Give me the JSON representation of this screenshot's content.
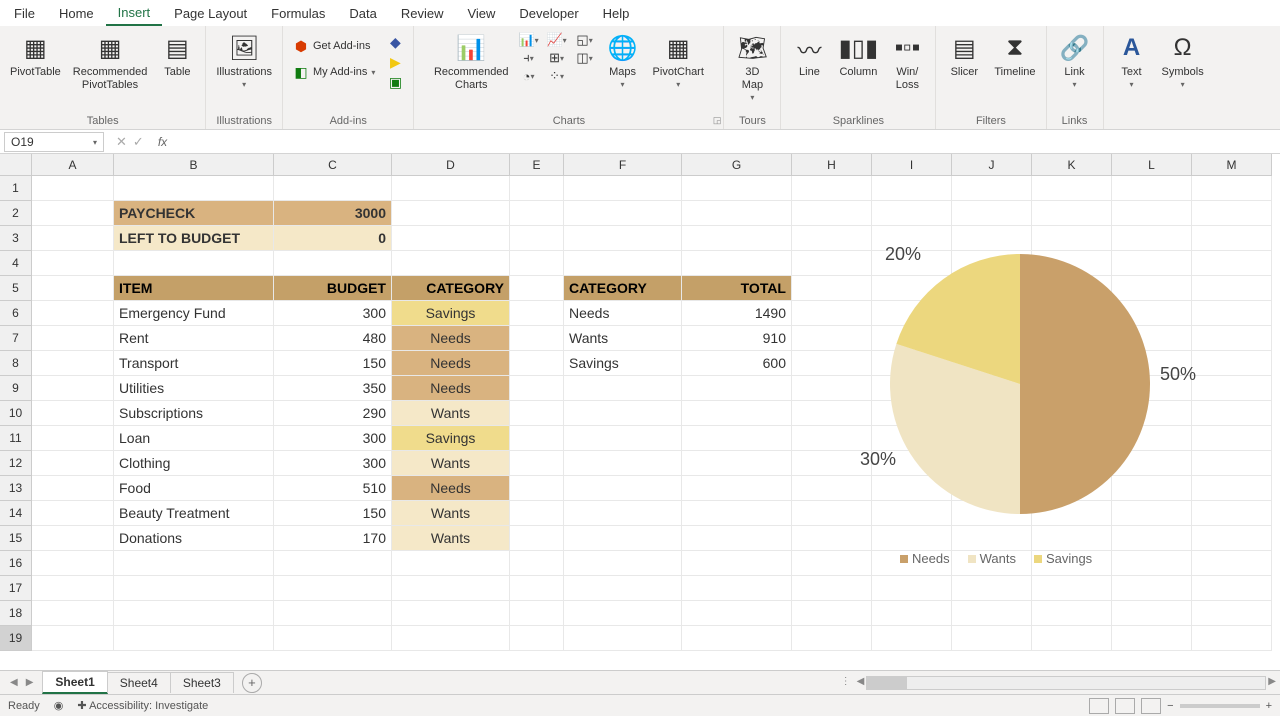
{
  "menu": {
    "tabs": [
      "File",
      "Home",
      "Insert",
      "Page Layout",
      "Formulas",
      "Data",
      "Review",
      "View",
      "Developer",
      "Help"
    ],
    "active": "Insert"
  },
  "ribbon": {
    "tables": {
      "pivot": "PivotTable",
      "rec": "Recommended\nPivotTables",
      "table": "Table",
      "label": "Tables"
    },
    "illus": {
      "btn": "Illustrations",
      "label": "Illustrations"
    },
    "addins": {
      "get": "Get Add-ins",
      "my": "My Add-ins",
      "label": "Add-ins"
    },
    "charts": {
      "rec": "Recommended\nCharts",
      "maps": "Maps",
      "pivotc": "PivotChart",
      "label": "Charts"
    },
    "tours": {
      "map3d": "3D\nMap",
      "label": "Tours"
    },
    "spark": {
      "line": "Line",
      "col": "Column",
      "winloss": "Win/\nLoss",
      "label": "Sparklines"
    },
    "filters": {
      "slicer": "Slicer",
      "timeline": "Timeline",
      "label": "Filters"
    },
    "links": {
      "link": "Link",
      "label": "Links"
    },
    "text": {
      "text": "Text",
      "label": ""
    },
    "symbols": {
      "sym": "Symbols",
      "label": ""
    }
  },
  "namebox": "O19",
  "formula": "",
  "columns": [
    "A",
    "B",
    "C",
    "D",
    "E",
    "F",
    "G",
    "H",
    "I",
    "J",
    "K",
    "L",
    "M"
  ],
  "budget": {
    "paycheck_label": "PAYCHECK",
    "paycheck_value": "3000",
    "left_label": "LEFT TO BUDGET",
    "left_value": "0",
    "hdr_item": "ITEM",
    "hdr_budget": "BUDGET",
    "hdr_category": "CATEGORY",
    "items": [
      {
        "name": "Emergency Fund",
        "budget": "300",
        "cat": "Savings",
        "cls": "savings-bg"
      },
      {
        "name": "Rent",
        "budget": "480",
        "cat": "Needs",
        "cls": "needs-bg"
      },
      {
        "name": "Transport",
        "budget": "150",
        "cat": "Needs",
        "cls": "needs-bg"
      },
      {
        "name": "Utilities",
        "budget": "350",
        "cat": "Needs",
        "cls": "needs-bg"
      },
      {
        "name": "Subscriptions",
        "budget": "290",
        "cat": "Wants",
        "cls": "wants-bg"
      },
      {
        "name": "Loan",
        "budget": "300",
        "cat": "Savings",
        "cls": "savings-bg"
      },
      {
        "name": "Clothing",
        "budget": "300",
        "cat": "Wants",
        "cls": "wants-bg"
      },
      {
        "name": "Food",
        "budget": "510",
        "cat": "Needs",
        "cls": "needs-bg"
      },
      {
        "name": "Beauty Treatment",
        "budget": "150",
        "cat": "Wants",
        "cls": "wants-bg"
      },
      {
        "name": "Donations",
        "budget": "170",
        "cat": "Wants",
        "cls": "wants-bg"
      }
    ],
    "sum_hdr_cat": "CATEGORY",
    "sum_hdr_total": "TOTAL",
    "summary": [
      {
        "cat": "Needs",
        "total": "1490"
      },
      {
        "cat": "Wants",
        "total": "910"
      },
      {
        "cat": "Savings",
        "total": "600"
      }
    ]
  },
  "chart_data": {
    "type": "pie",
    "categories": [
      "Needs",
      "Wants",
      "Savings"
    ],
    "values": [
      50,
      30,
      20
    ],
    "colors": {
      "Needs": "#c9a06a",
      "Wants": "#f0e4c3",
      "Savings": "#ecd77e"
    },
    "labels": [
      "50%",
      "30%",
      "20%"
    ],
    "legend": [
      "Needs",
      "Wants",
      "Savings"
    ]
  },
  "sheets": {
    "tabs": [
      "Sheet1",
      "Sheet4",
      "Sheet3"
    ],
    "active": "Sheet1"
  },
  "status": {
    "ready": "Ready",
    "access": "Accessibility: Investigate"
  }
}
